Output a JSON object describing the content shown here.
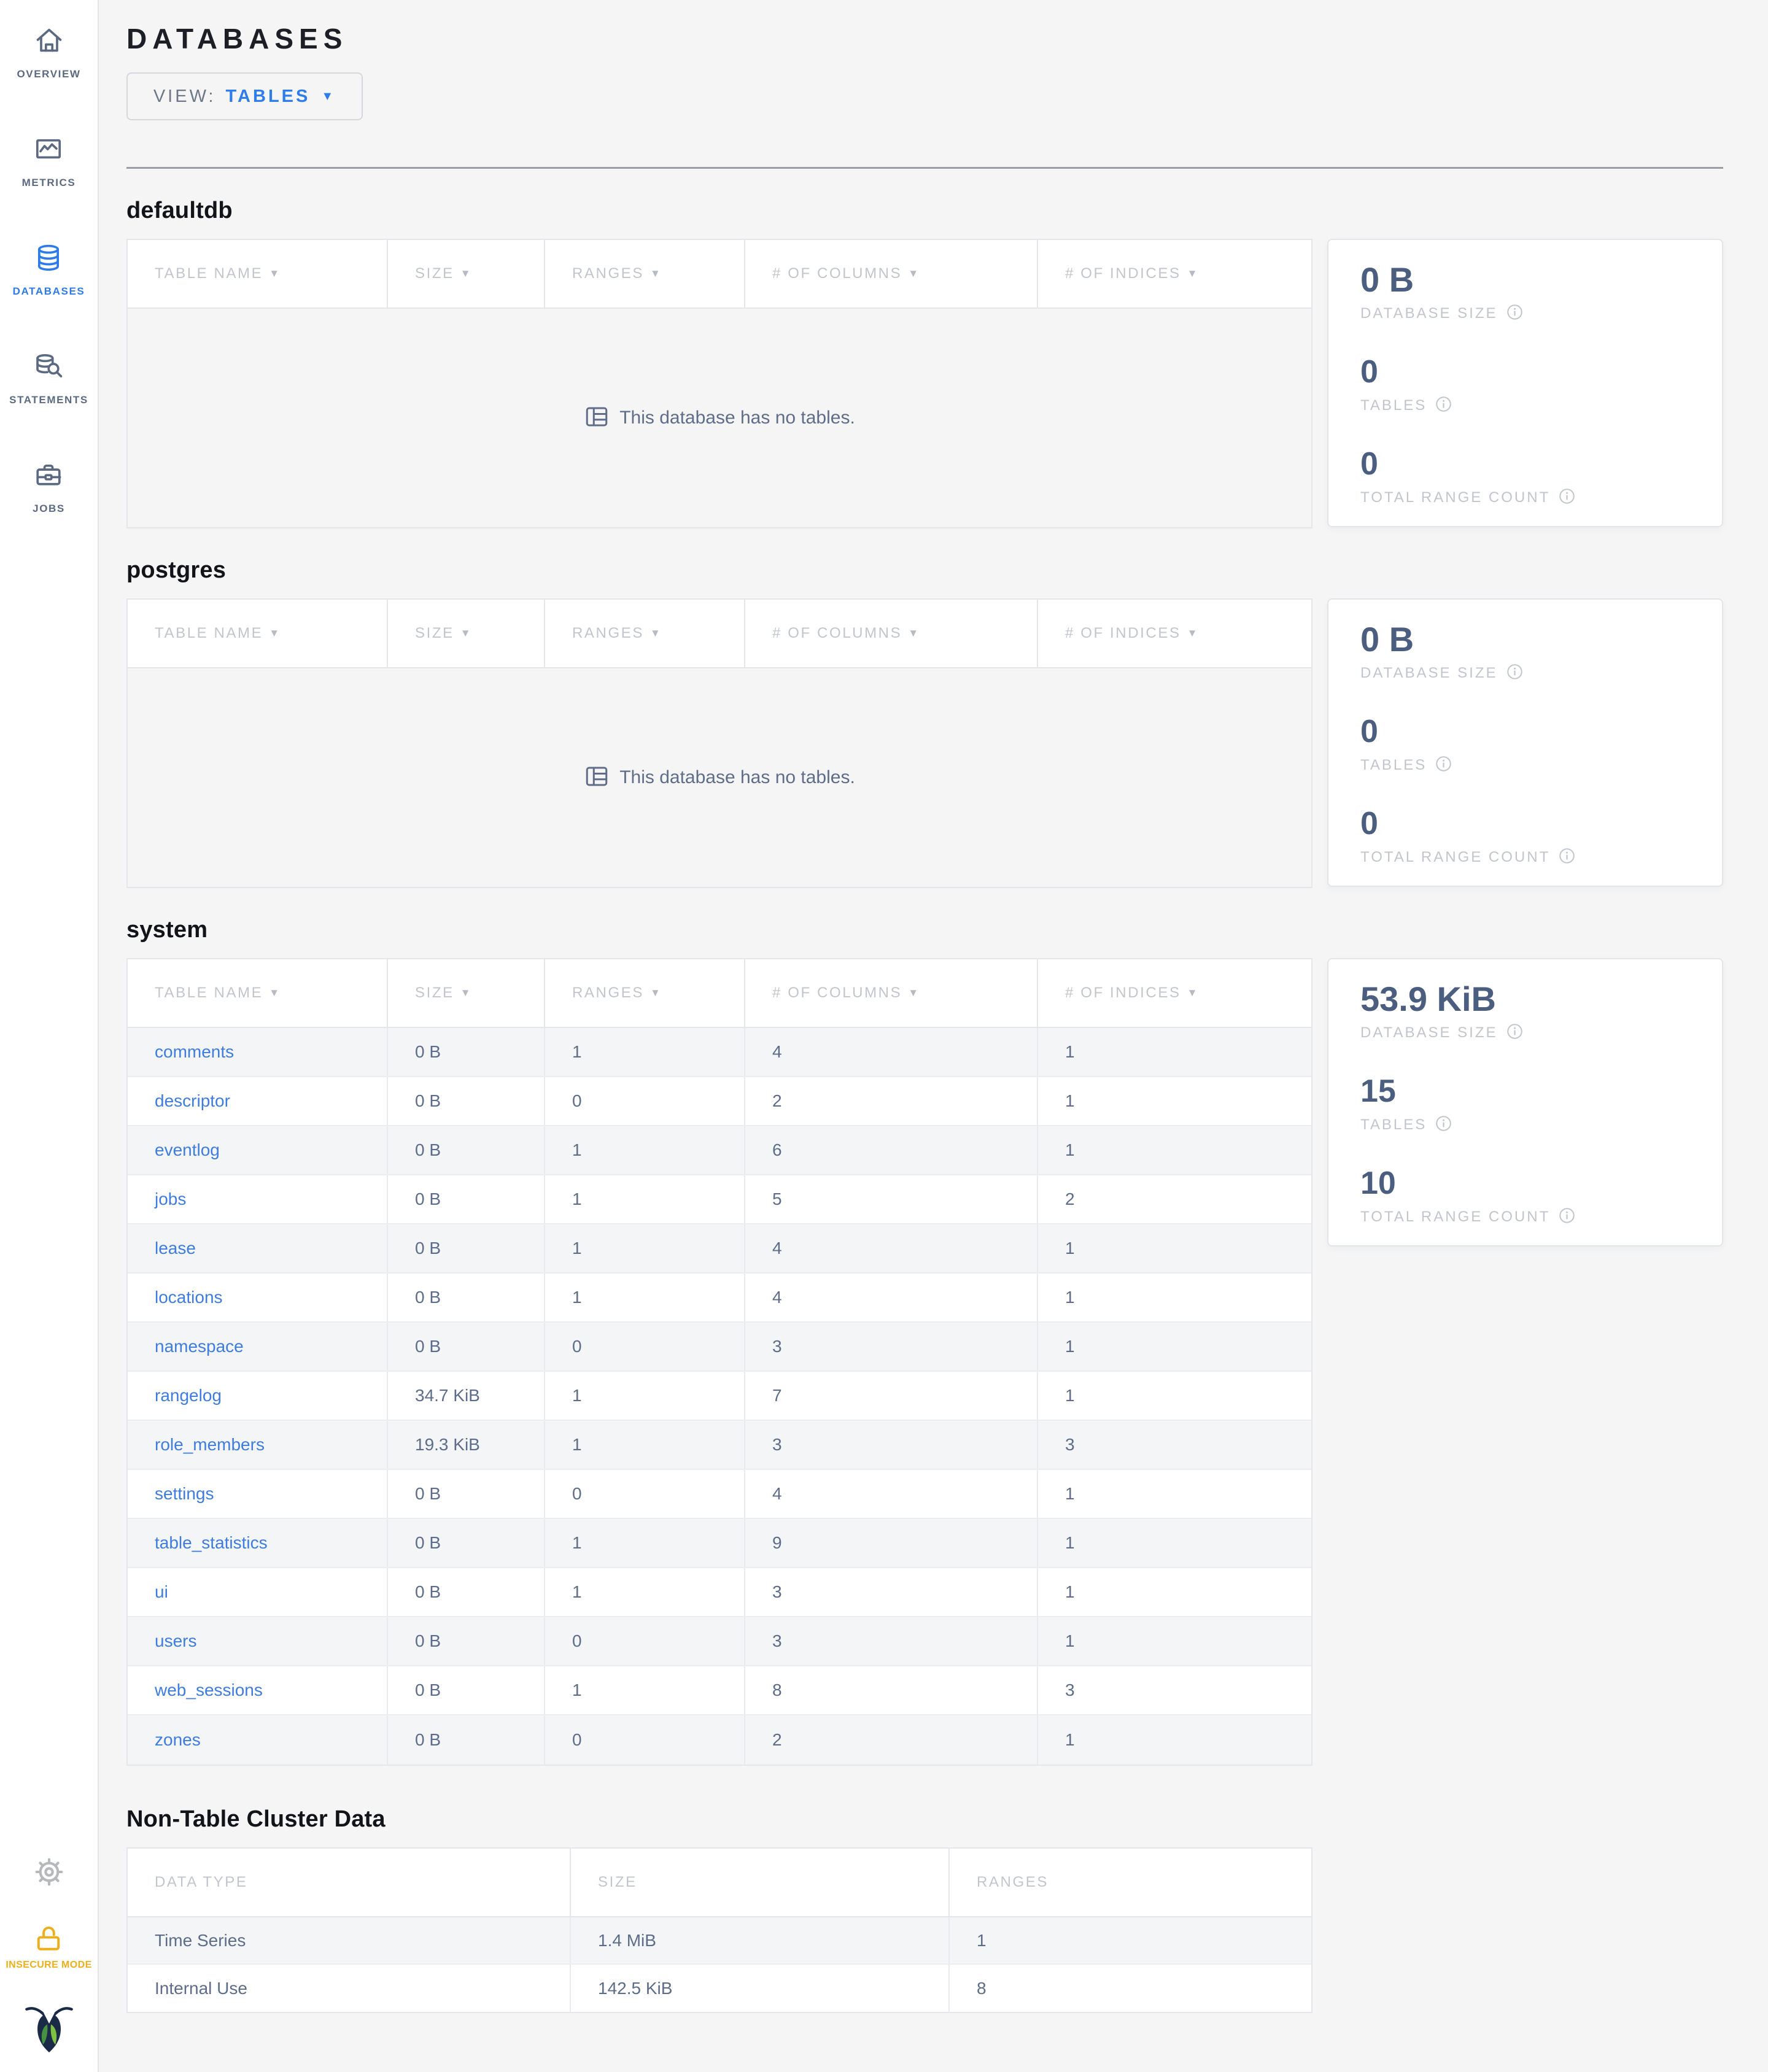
{
  "sidebar": {
    "items": [
      {
        "label": "OVERVIEW",
        "icon": "home-icon",
        "active": false
      },
      {
        "label": "METRICS",
        "icon": "metrics-icon",
        "active": false
      },
      {
        "label": "DATABASES",
        "icon": "databases-icon",
        "active": true
      },
      {
        "label": "STATEMENTS",
        "icon": "statements-icon",
        "active": false
      },
      {
        "label": "JOBS",
        "icon": "jobs-icon",
        "active": false
      }
    ],
    "insecure_label": "INSECURE MODE"
  },
  "header": {
    "title": "DATABASES",
    "view_label": "VIEW:",
    "view_value": "TABLES",
    "view_caret": "▼"
  },
  "table_columns": [
    "TABLE NAME",
    "SIZE",
    "RANGES",
    "# OF COLUMNS",
    "# OF INDICES"
  ],
  "sort_arrow": "▼",
  "empty_message": "This database has no tables.",
  "stats_labels": {
    "size": "DATABASE SIZE",
    "tables": "TABLES",
    "ranges": "TOTAL RANGE COUNT"
  },
  "databases": [
    {
      "name": "defaultdb",
      "stats": {
        "size": "0 B",
        "tables": "0",
        "ranges": "0"
      },
      "rows": []
    },
    {
      "name": "postgres",
      "stats": {
        "size": "0 B",
        "tables": "0",
        "ranges": "0"
      },
      "rows": []
    },
    {
      "name": "system",
      "stats": {
        "size": "53.9 KiB",
        "tables": "15",
        "ranges": "10"
      },
      "rows": [
        {
          "name": "comments",
          "size": "0 B",
          "ranges": "1",
          "columns": "4",
          "indices": "1"
        },
        {
          "name": "descriptor",
          "size": "0 B",
          "ranges": "0",
          "columns": "2",
          "indices": "1"
        },
        {
          "name": "eventlog",
          "size": "0 B",
          "ranges": "1",
          "columns": "6",
          "indices": "1"
        },
        {
          "name": "jobs",
          "size": "0 B",
          "ranges": "1",
          "columns": "5",
          "indices": "2"
        },
        {
          "name": "lease",
          "size": "0 B",
          "ranges": "1",
          "columns": "4",
          "indices": "1"
        },
        {
          "name": "locations",
          "size": "0 B",
          "ranges": "1",
          "columns": "4",
          "indices": "1"
        },
        {
          "name": "namespace",
          "size": "0 B",
          "ranges": "0",
          "columns": "3",
          "indices": "1"
        },
        {
          "name": "rangelog",
          "size": "34.7 KiB",
          "ranges": "1",
          "columns": "7",
          "indices": "1"
        },
        {
          "name": "role_members",
          "size": "19.3 KiB",
          "ranges": "1",
          "columns": "3",
          "indices": "3"
        },
        {
          "name": "settings",
          "size": "0 B",
          "ranges": "0",
          "columns": "4",
          "indices": "1"
        },
        {
          "name": "table_statistics",
          "size": "0 B",
          "ranges": "1",
          "columns": "9",
          "indices": "1"
        },
        {
          "name": "ui",
          "size": "0 B",
          "ranges": "1",
          "columns": "3",
          "indices": "1"
        },
        {
          "name": "users",
          "size": "0 B",
          "ranges": "0",
          "columns": "3",
          "indices": "1"
        },
        {
          "name": "web_sessions",
          "size": "0 B",
          "ranges": "1",
          "columns": "8",
          "indices": "3"
        },
        {
          "name": "zones",
          "size": "0 B",
          "ranges": "0",
          "columns": "2",
          "indices": "1"
        }
      ]
    }
  ],
  "non_table": {
    "title": "Non-Table Cluster Data",
    "columns": [
      "DATA TYPE",
      "SIZE",
      "RANGES"
    ],
    "rows": [
      {
        "type": "Time Series",
        "size": "1.4 MiB",
        "ranges": "1"
      },
      {
        "type": "Internal Use",
        "size": "142.5 KiB",
        "ranges": "8"
      }
    ]
  },
  "colors": {
    "accent_blue": "#2d7bea",
    "link_blue": "#3e7ce0",
    "slate": "#5d6d89",
    "insecure_amber": "#edae1c",
    "logo_navy": "#1b2a47",
    "logo_green_dark": "#459341",
    "logo_green_light": "#7fc143"
  }
}
